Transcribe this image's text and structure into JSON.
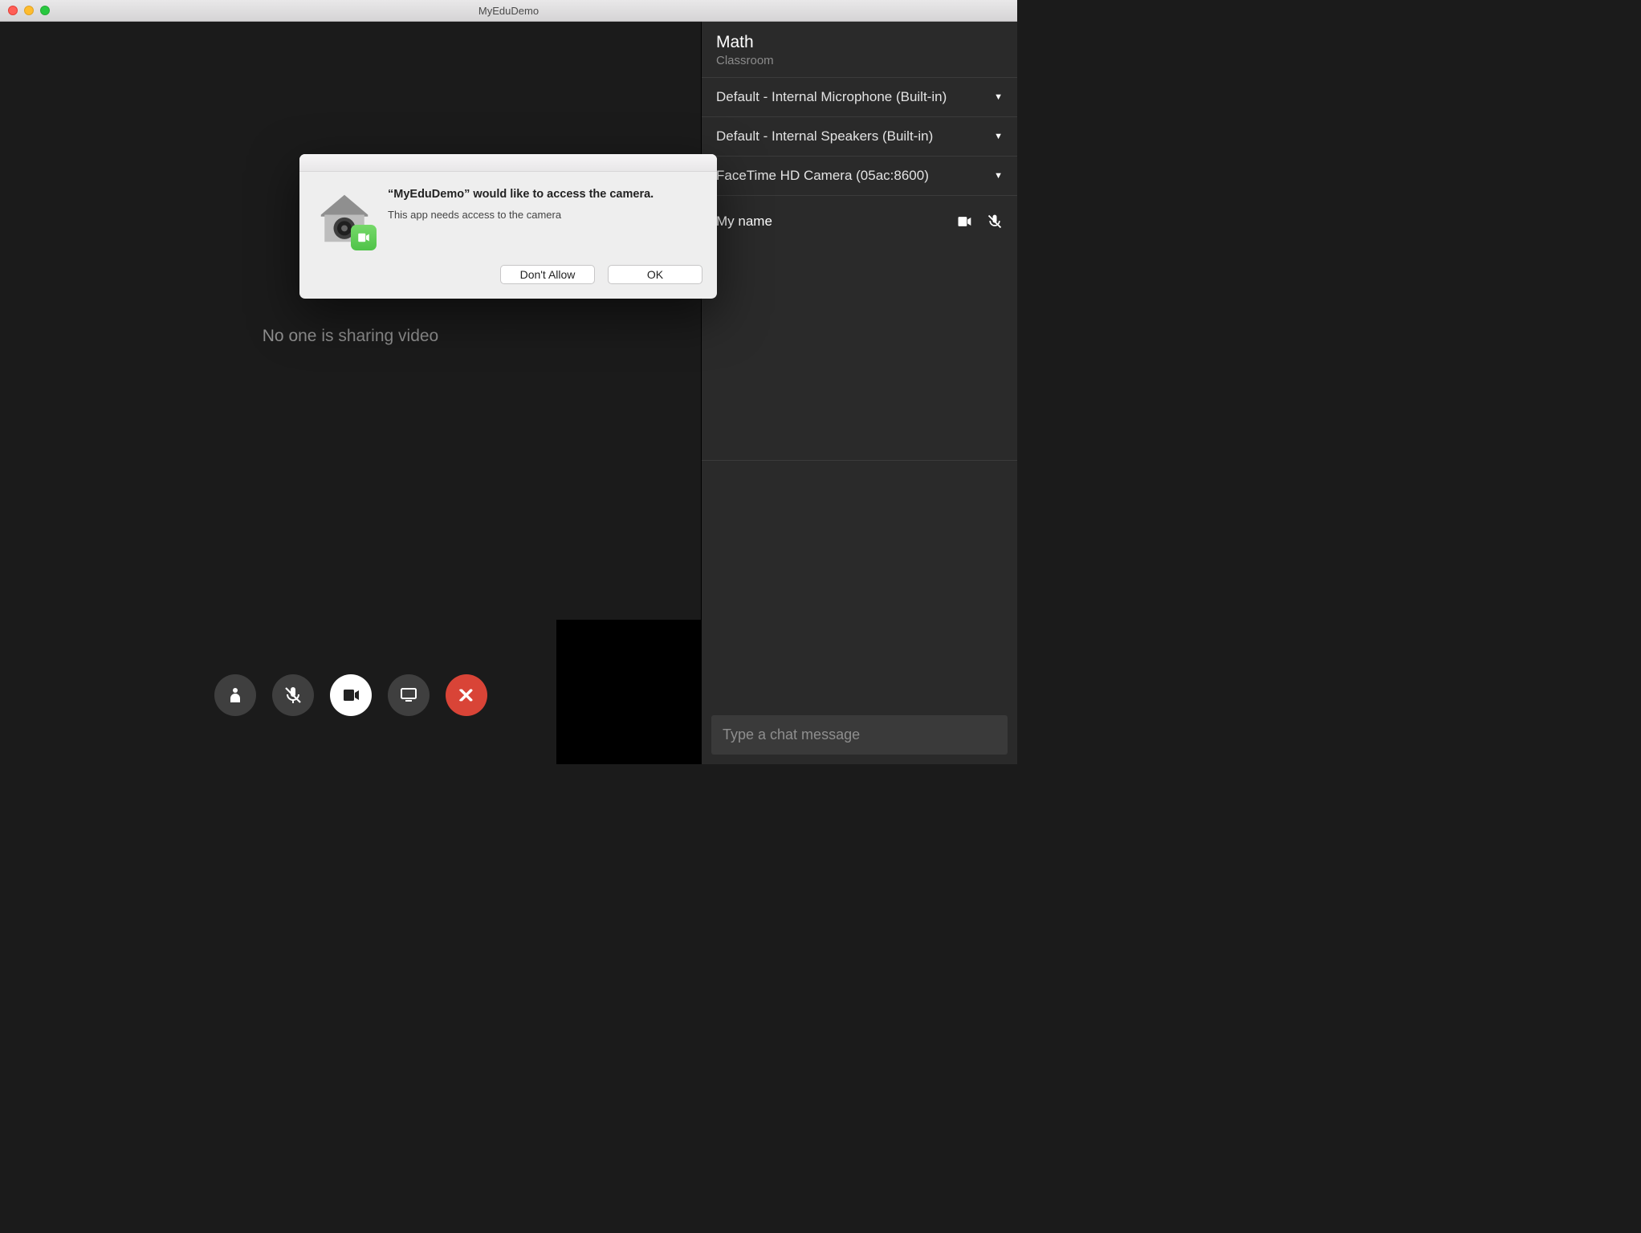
{
  "window": {
    "title": "MyEduDemo"
  },
  "main": {
    "no_share": "No one is sharing video"
  },
  "sidebar": {
    "title": "Math",
    "subtitle": "Classroom",
    "devices": {
      "mic": "Default - Internal Microphone (Built-in)",
      "speaker": "Default - Internal Speakers (Built-in)",
      "camera": "FaceTime HD Camera (05ac:8600)"
    },
    "participant": {
      "name": "My name"
    },
    "chat_placeholder": "Type a chat message"
  },
  "modal": {
    "headline": "“MyEduDemo” would like to access the camera.",
    "subline": "This app needs access to the camera",
    "dont_allow": "Don't Allow",
    "ok": "OK"
  }
}
